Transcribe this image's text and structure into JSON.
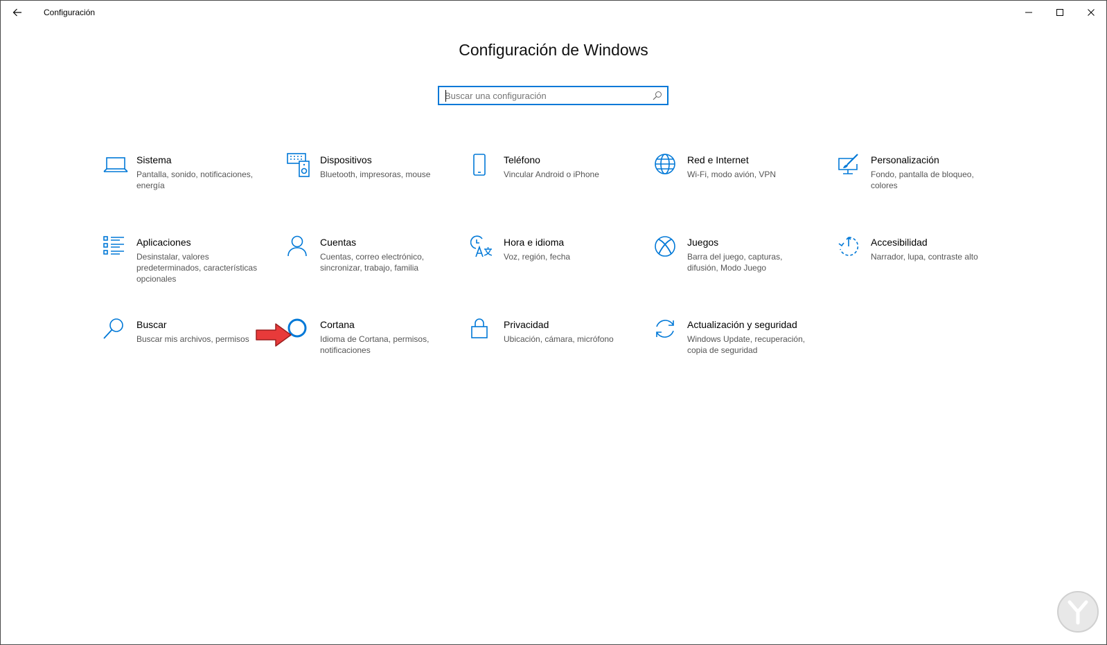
{
  "window": {
    "app_title": "Configuración",
    "back_icon": "arrow-left-icon",
    "minimize_icon": "minimize-icon",
    "maximize_icon": "maximize-icon",
    "close_icon": "close-icon"
  },
  "header": {
    "title": "Configuración de Windows"
  },
  "search": {
    "placeholder": "Buscar una configuración",
    "value": "",
    "icon": "search-icon"
  },
  "accent_color": "#0078d7",
  "annotation_color": "#e83a3a",
  "categories": [
    {
      "icon": "laptop-icon",
      "title": "Sistema",
      "desc": "Pantalla, sonido, notificaciones, energía"
    },
    {
      "icon": "keyboard-speaker-icon",
      "title": "Dispositivos",
      "desc": "Bluetooth, impresoras, mouse"
    },
    {
      "icon": "phone-icon",
      "title": "Teléfono",
      "desc": "Vincular Android o iPhone"
    },
    {
      "icon": "globe-icon",
      "title": "Red e Internet",
      "desc": "Wi-Fi, modo avión, VPN"
    },
    {
      "icon": "paint-brush-icon",
      "title": "Personalización",
      "desc": "Fondo, pantalla de bloqueo, colores"
    },
    {
      "icon": "apps-list-icon",
      "title": "Aplicaciones",
      "desc": "Desinstalar, valores predeterminados, características opcionales"
    },
    {
      "icon": "person-icon",
      "title": "Cuentas",
      "desc": "Cuentas, correo electrónico, sincronizar, trabajo, familia"
    },
    {
      "icon": "time-language-icon",
      "title": "Hora e idioma",
      "desc": "Voz, región, fecha"
    },
    {
      "icon": "xbox-icon",
      "title": "Juegos",
      "desc": "Barra del juego, capturas, difusión, Modo Juego"
    },
    {
      "icon": "accessibility-icon",
      "title": "Accesibilidad",
      "desc": "Narrador, lupa, contraste alto"
    },
    {
      "icon": "magnifier-icon",
      "title": "Buscar",
      "desc": "Buscar mis archivos, permisos"
    },
    {
      "icon": "cortana-circle-icon",
      "title": "Cortana",
      "desc": "Idioma de Cortana, permisos, notificaciones"
    },
    {
      "icon": "padlock-icon",
      "title": "Privacidad",
      "desc": "Ubicación, cámara, micrófono"
    },
    {
      "icon": "sync-arrows-icon",
      "title": "Actualización y seguridad",
      "desc": "Windows Update, recuperación, copia de seguridad"
    }
  ]
}
